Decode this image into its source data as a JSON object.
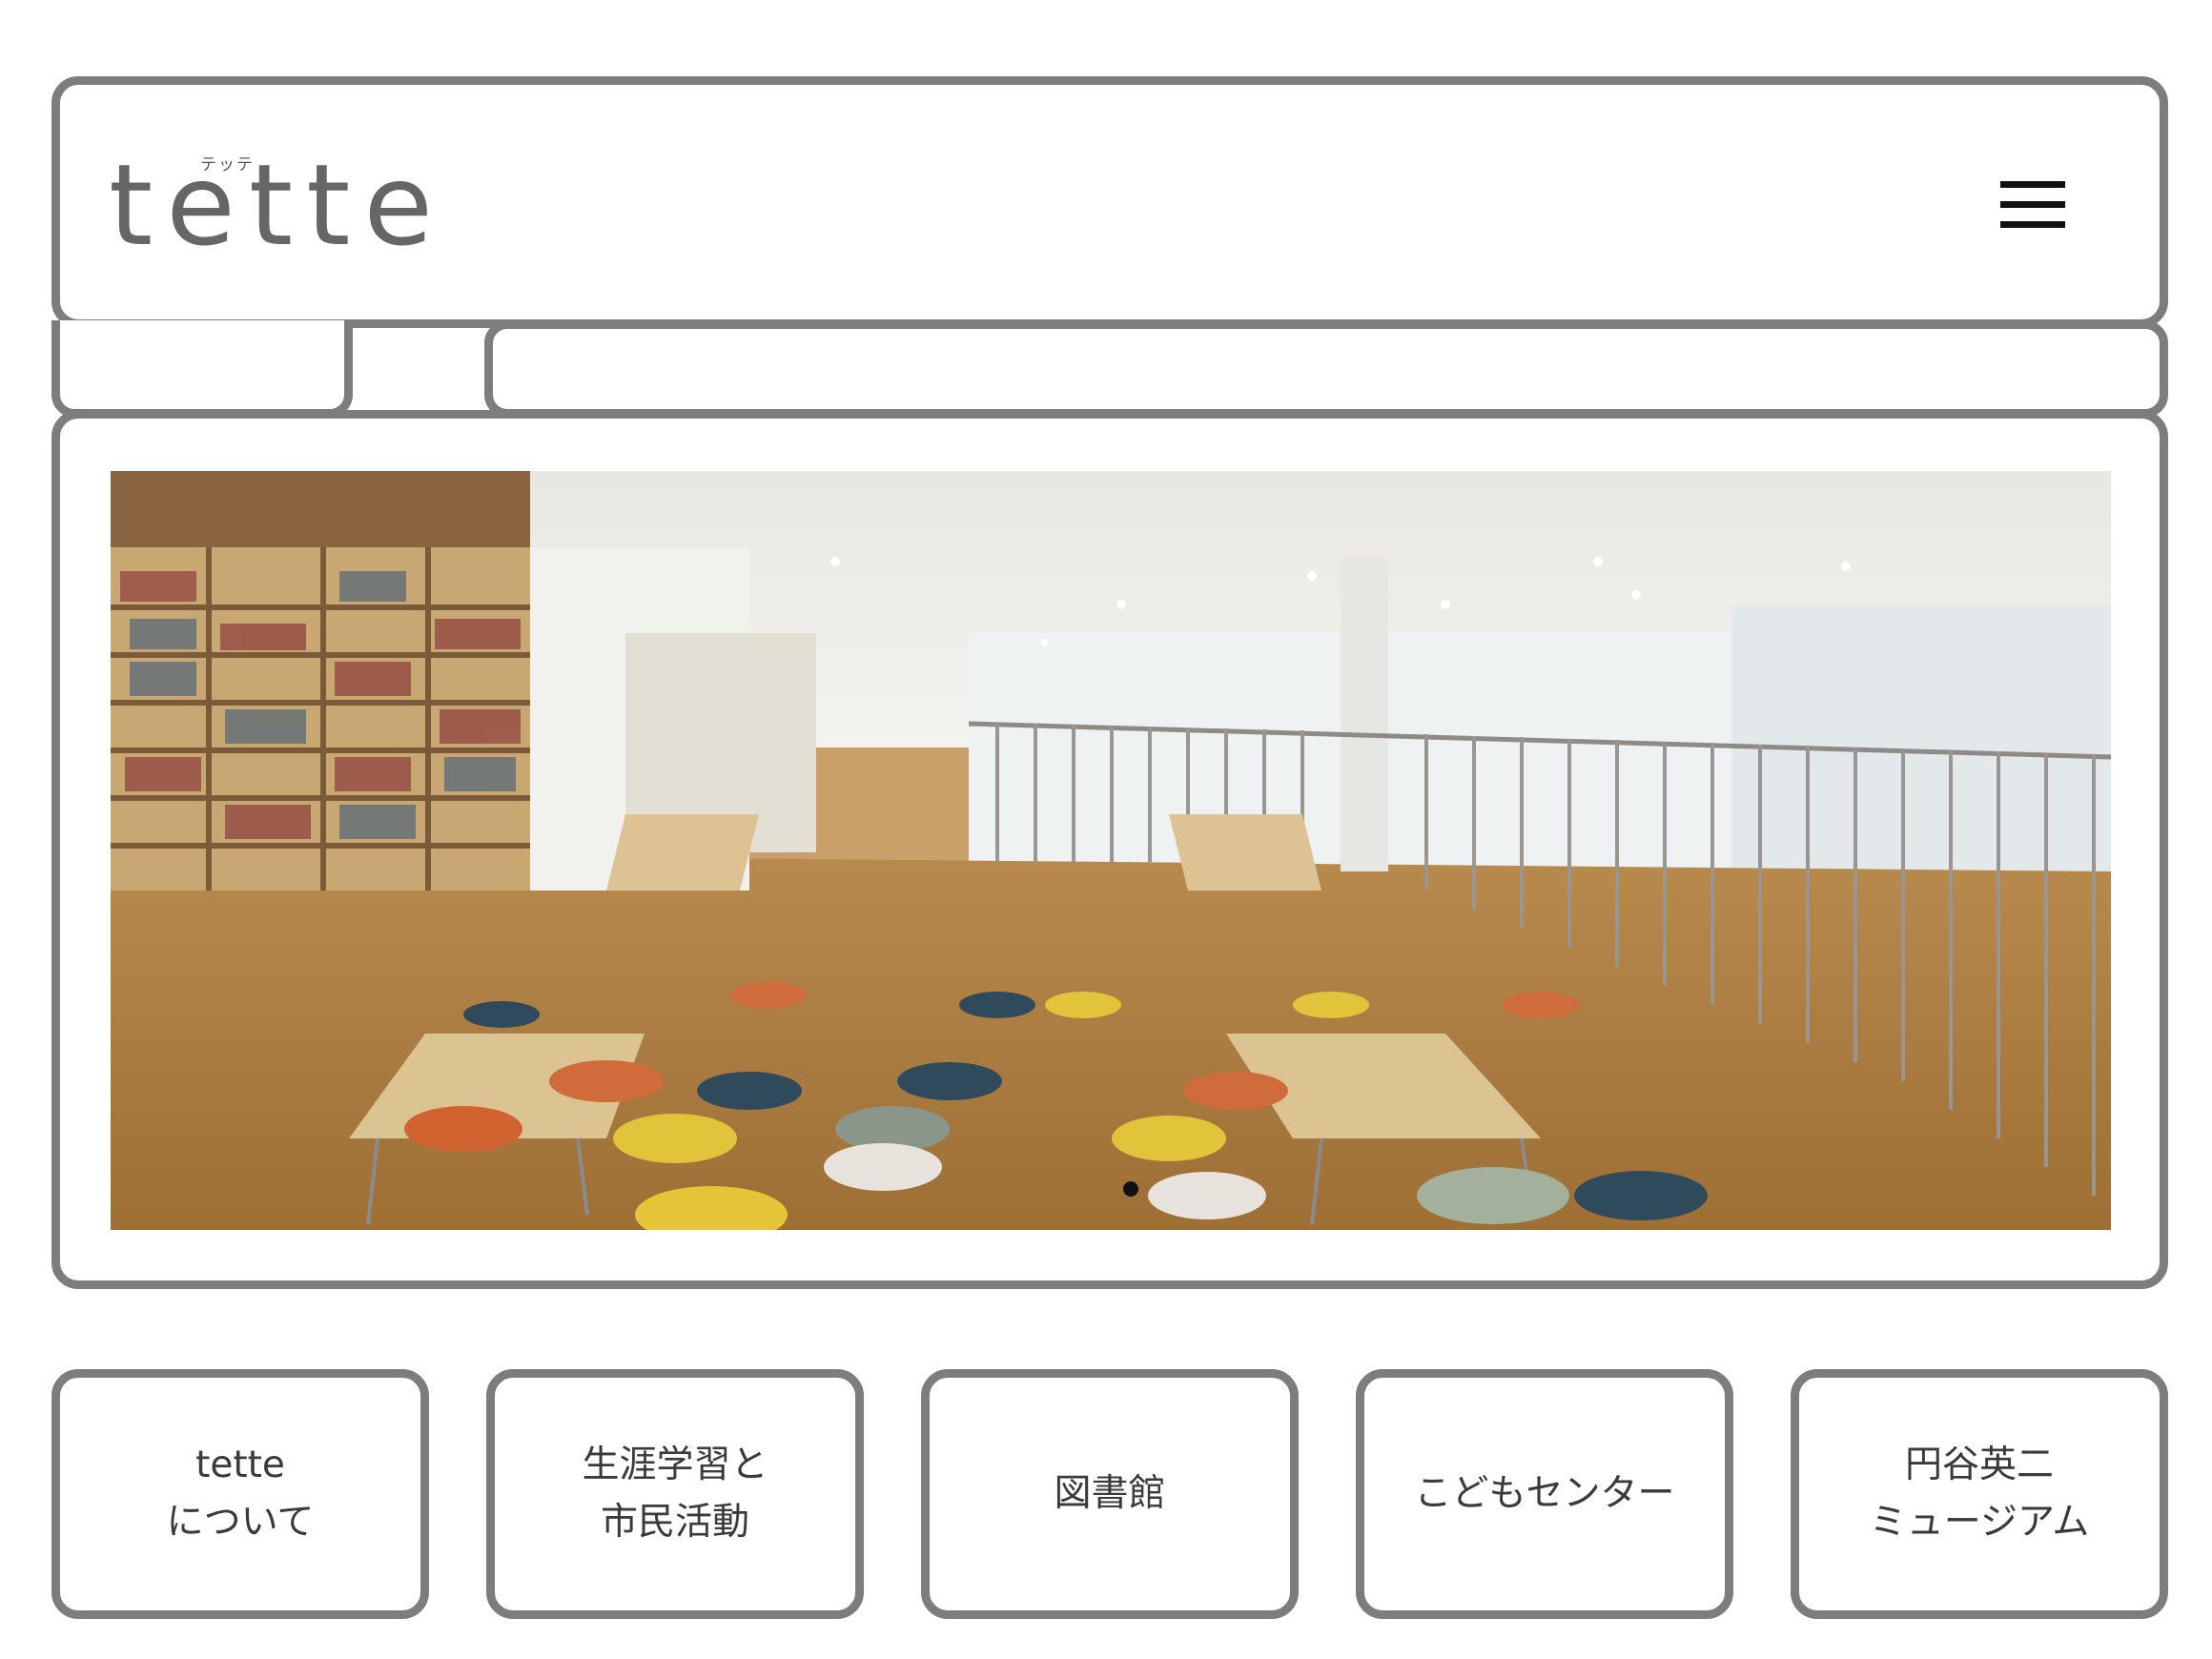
{
  "header": {
    "logo": {
      "ruby": "テッテ",
      "wordmark": "tette"
    },
    "menu_icon": "hamburger-menu-icon"
  },
  "hero": {
    "image": "photo of library reading area with bookshelves, wooden tables, colorful stools and railing",
    "slide_count": 1,
    "active_slide": 1
  },
  "nav_tiles": [
    {
      "label": "tette\nについて"
    },
    {
      "label": "生涯学習と\n市民活動"
    },
    {
      "label": "図書館"
    },
    {
      "label": "こどもセンター"
    },
    {
      "label": "円谷英二\nミュージアム"
    }
  ],
  "colors": {
    "frame_border": "#7d7d7d",
    "logo_text": "#666666",
    "label_text": "#3a3a3a",
    "background": "#ffffff"
  }
}
